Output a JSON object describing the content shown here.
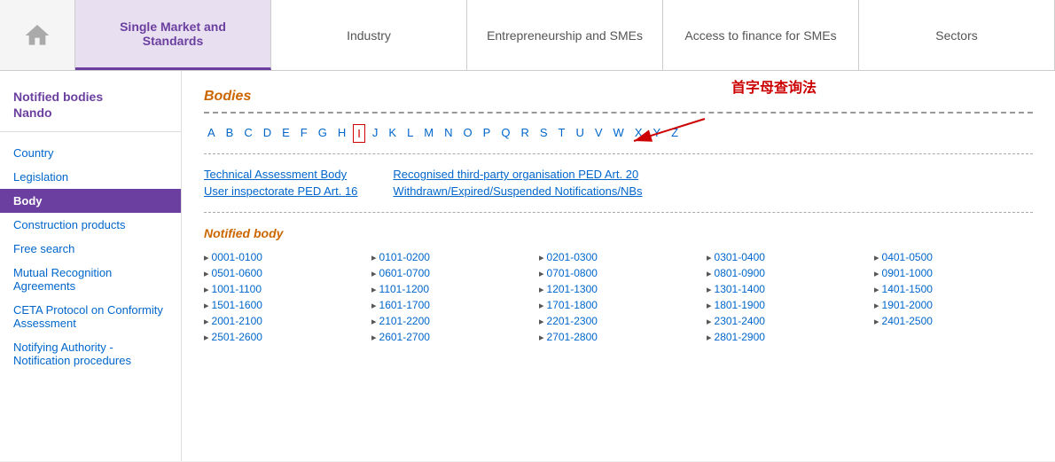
{
  "nav": {
    "items": [
      {
        "id": "home",
        "label": "Home",
        "active": false
      },
      {
        "id": "single-market",
        "label": "Single Market and Standards",
        "active": true
      },
      {
        "id": "industry",
        "label": "Industry",
        "active": false
      },
      {
        "id": "entrepreneurship",
        "label": "Entrepreneurship and SMEs",
        "active": false
      },
      {
        "id": "access-finance",
        "label": "Access to finance for SMEs",
        "active": false
      },
      {
        "id": "sectors",
        "label": "Sectors",
        "active": false
      }
    ]
  },
  "sidebar": {
    "title_line1": "Notified bodies",
    "title_line2": "Nando",
    "links": [
      {
        "id": "country",
        "label": "Country",
        "active": false
      },
      {
        "id": "legislation",
        "label": "Legislation",
        "active": false
      },
      {
        "id": "body",
        "label": "Body",
        "active": true
      },
      {
        "id": "construction",
        "label": "Construction products",
        "active": false
      },
      {
        "id": "free-search",
        "label": "Free search",
        "active": false
      },
      {
        "id": "mutual",
        "label": "Mutual Recognition Agreements",
        "active": false
      },
      {
        "id": "ceta",
        "label": "CETA Protocol on Conformity Assessment",
        "active": false
      },
      {
        "id": "notifying",
        "label": "Notifying Authority - Notification procedures",
        "active": false
      }
    ]
  },
  "content": {
    "bodies_title": "Bodies",
    "annotation_text": "首字母查询法",
    "alphabet": [
      "A",
      "B",
      "C",
      "D",
      "E",
      "F",
      "G",
      "H",
      "I",
      "J",
      "K",
      "L",
      "M",
      "N",
      "O",
      "P",
      "Q",
      "R",
      "S",
      "T",
      "U",
      "V",
      "W",
      "X",
      "Y",
      "Z"
    ],
    "selected_letter": "I",
    "top_links_col1": [
      "Technical Assessment Body",
      "User inspectorate PED Art. 16"
    ],
    "top_links_col2": [
      "Recognised third-party organisation PED Art. 20",
      "Withdrawn/Expired/Suspended Notifications/NBs"
    ],
    "notified_body_title": "Notified body",
    "number_ranges": [
      "0001-0100",
      "0101-0200",
      "0201-0300",
      "0301-0400",
      "0401-0500",
      "0501-0600",
      "0601-0700",
      "0701-0800",
      "0801-0900",
      "0901-1000",
      "1001-1100",
      "1101-1200",
      "1201-1300",
      "1301-1400",
      "1401-1500",
      "1501-1600",
      "1601-1700",
      "1701-1800",
      "1801-1900",
      "1901-2000",
      "2001-2100",
      "2101-2200",
      "2201-2300",
      "2301-2400",
      "2401-2500",
      "2501-2600",
      "2601-2700",
      "2701-2800",
      "2801-2900",
      ""
    ]
  }
}
